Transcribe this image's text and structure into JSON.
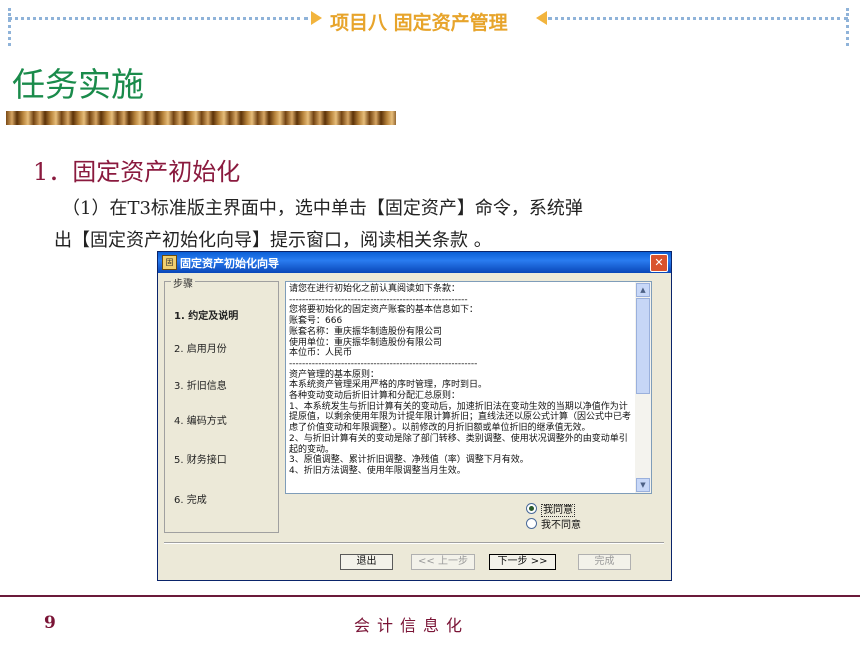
{
  "header": {
    "project_title": "项目八 固定资产管理"
  },
  "section_title": "任务实施",
  "heading": "1．固定资产初始化",
  "paragraph": {
    "line1": "（1）在T3标准版主界面中，选中单击【固定资产】命令，系统弹",
    "line2": "出【固定资产初始化向导】提示窗口，阅读相关条款 。"
  },
  "dialog": {
    "title": "固定资产初始化向导",
    "steps_legend": "步骤",
    "steps": [
      "1. 约定及说明",
      "2. 启用月份",
      "3. 折旧信息",
      "4. 编码方式",
      "5. 财务接口",
      "6. 完成"
    ],
    "active_step": 0,
    "terms_text": "请您在进行初始化之前认真阅读如下条款：\n-------------------------------------------------------\n您将要初始化的固定资产账套的基本信息如下：\n账套号：666\n账套名称：重庆振华制造股份有限公司\n使用单位：重庆振华制造股份有限公司\n本位币：人民币\n----------------------------------------------------------\n资产管理的基本原则：\n本系统资产管理采用严格的序时管理，序时到日。\n各种变动变动后折旧计算和分配汇总原则：\n1、本系统发生与折旧计算有关的变动后，加速折旧法在变动生效的当期以净值作为计提原值，以剩余使用年限为计提年限计算折旧；直线法还以原公式计算（因公式中已考虑了价值变动和年限调整）。以前修改的月折旧额或单位折旧的继承值无效。\n2、与折旧计算有关的变动是除了部门转移、类别调整、使用状况调整外的由变动单引起的变动。\n3、原值调整、累计折旧调整、净残值（率）调整下月有效。\n4、折旧方法调整、使用年限调整当月生效。",
    "radio_agree": "我同意",
    "radio_disagree": "我不同意",
    "agree_selected": true,
    "buttons": {
      "exit": "退出",
      "prev": "<< 上一步",
      "next": "下一步 >>",
      "finish": "完成"
    }
  },
  "footer": {
    "page_number": "9",
    "text": "会计信息化"
  }
}
